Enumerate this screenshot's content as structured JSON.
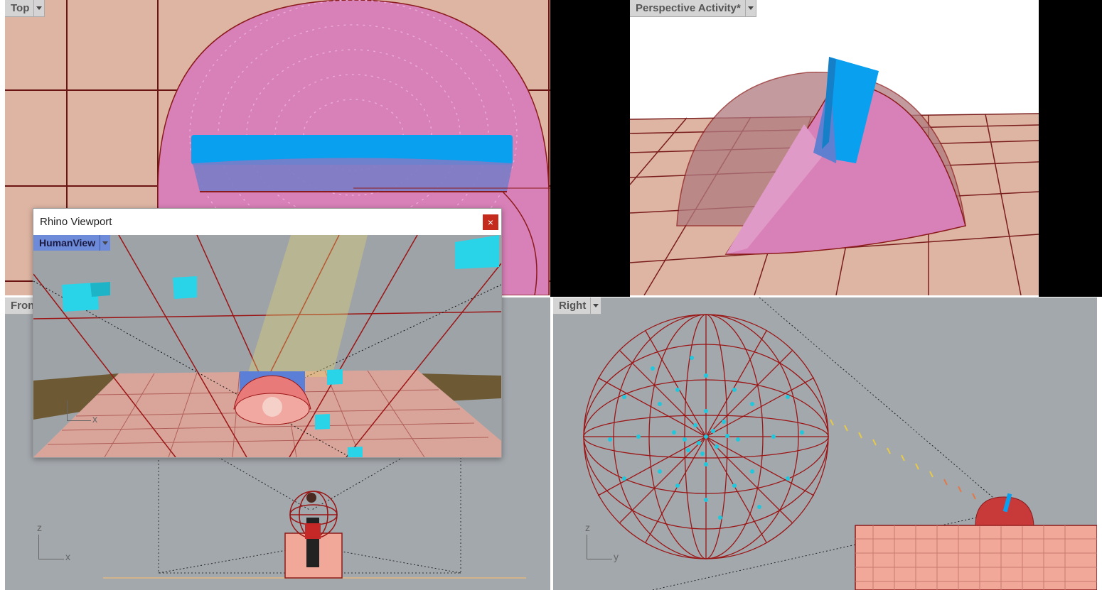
{
  "viewports": {
    "top": {
      "title": "Top"
    },
    "perspective": {
      "title": "Perspective Activity*"
    },
    "front": {
      "title": "Front",
      "axis_v": "z",
      "axis_h": "x"
    },
    "right": {
      "title": "Right",
      "axis_v": "z",
      "axis_h": "y"
    }
  },
  "floating_window": {
    "title": "Rhino Viewport",
    "close_glyph": "×",
    "view_name": "HumanView",
    "axis_h": "x"
  },
  "colors": {
    "dome_pink": "#d77cb8",
    "floor_salmon": "#deb5a3",
    "grid_red": "#8b1a1a",
    "block_blue": "#0aa0f0",
    "cube_cyan": "#22c4d8",
    "viewport_gray": "#a3a8ad"
  }
}
